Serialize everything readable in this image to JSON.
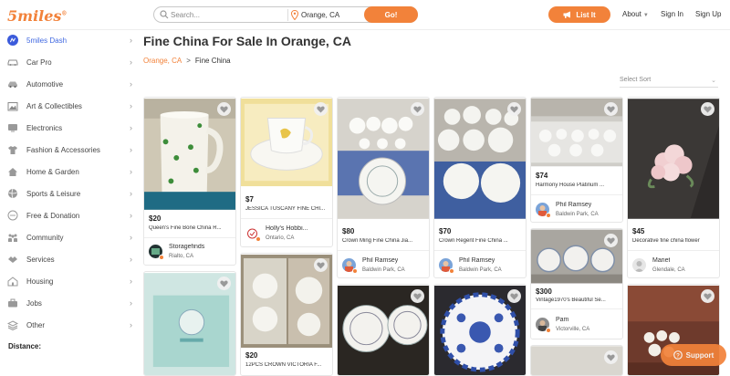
{
  "header": {
    "logo": "5miles",
    "logo_mark": "®",
    "search_placeholder": "Search...",
    "location_value": "Orange, CA",
    "go_label": "Go!",
    "list_it_label": "List It",
    "about_label": "About",
    "sign_in_label": "Sign In",
    "sign_up_label": "Sign Up",
    "accent_color": "#f2823a"
  },
  "sidebar": {
    "items": [
      {
        "label": "5miles Dash",
        "icon": "dash-icon"
      },
      {
        "label": "Car Pro",
        "icon": "car-icon"
      },
      {
        "label": "Automotive",
        "icon": "automotive-icon"
      },
      {
        "label": "Art & Collectibles",
        "icon": "art-icon"
      },
      {
        "label": "Electronics",
        "icon": "electronics-icon"
      },
      {
        "label": "Fashion & Accessories",
        "icon": "shirt-icon"
      },
      {
        "label": "Home & Garden",
        "icon": "home-icon"
      },
      {
        "label": "Sports & Leisure",
        "icon": "sports-icon"
      },
      {
        "label": "Free & Donation",
        "icon": "donation-icon"
      },
      {
        "label": "Community",
        "icon": "community-icon"
      },
      {
        "label": "Services",
        "icon": "services-icon"
      },
      {
        "label": "Housing",
        "icon": "housing-icon"
      },
      {
        "label": "Jobs",
        "icon": "jobs-icon"
      },
      {
        "label": "Other",
        "icon": "other-icon"
      }
    ],
    "distance_label": "Distance:"
  },
  "main": {
    "title": "Fine China For Sale In Orange, CA",
    "breadcrumb_link": "Orange, CA",
    "breadcrumb_sep": ">",
    "breadcrumb_current": "Fine China",
    "sort_label": "Select Sort"
  },
  "listings": [
    {
      "price": "$20",
      "title": "Queen's Fine Bone China R...",
      "seller": "Storagefinds",
      "location": "Rialto, CA"
    },
    {
      "price": "$7",
      "title": "JESSICA TUSCANY FINE CHI...",
      "seller": "Holly's Hobbi...",
      "location": "Ontario, CA"
    },
    {
      "price": "$80",
      "title": "Crown Ming Fine China Jia...",
      "seller": "Phil Ramsey",
      "location": "Baldwin Park, CA"
    },
    {
      "price": "$70",
      "title": "Crown Regent Fine China ...",
      "seller": "Phil Ramsey",
      "location": "Baldwin Park, CA"
    },
    {
      "price": "$74",
      "title": "Harmony House Platinum ...",
      "seller": "Phil Ramsey",
      "location": "Baldwin Park, CA"
    },
    {
      "price": "$45",
      "title": "Decorative fine china flower",
      "seller": "Mariet",
      "location": "Glendale, CA"
    },
    {
      "price": "$300",
      "title": "Vintage1970's Beautiful Se...",
      "seller": "Pam",
      "location": "Victorville, CA"
    },
    {
      "price": "$20",
      "title": "12PCS CROWN VICTORIA F..."
    }
  ],
  "support_label": "Support"
}
